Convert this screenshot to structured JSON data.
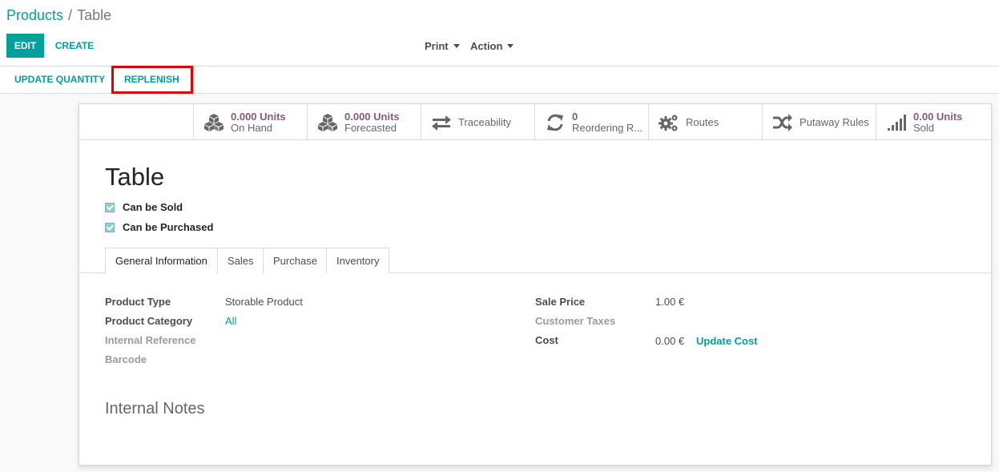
{
  "breadcrumb": {
    "parent": "Products",
    "separator": "/",
    "current": "Table"
  },
  "toolbar": {
    "edit_label": "EDIT",
    "create_label": "CREATE",
    "print_label": "Print",
    "action_label": "Action"
  },
  "statusbar": {
    "update_quantity_label": "UPDATE QUANTITY",
    "replenish_label": "REPLENISH"
  },
  "smart_buttons": [
    {
      "value": "0.000 Units",
      "label": "On Hand",
      "icon": "cubes-icon"
    },
    {
      "value": "0.000 Units",
      "label": "Forecasted",
      "icon": "cubes-icon"
    },
    {
      "label": "Traceability",
      "icon": "exchange-arrows-icon"
    },
    {
      "value": "0",
      "label": "Reordering R...",
      "icon": "refresh-icon"
    },
    {
      "label": "Routes",
      "icon": "gears-icon"
    },
    {
      "label": "Putaway Rules",
      "icon": "random-icon"
    },
    {
      "value": "0.00 Units",
      "label": "Sold",
      "icon": "signal-bars-icon"
    }
  ],
  "product": {
    "name": "Table",
    "can_be_sold_label": "Can be Sold",
    "can_be_purchased_label": "Can be Purchased"
  },
  "tabs": [
    "General Information",
    "Sales",
    "Purchase",
    "Inventory"
  ],
  "general_info": {
    "product_type_label": "Product Type",
    "product_type_value": "Storable Product",
    "product_category_label": "Product Category",
    "product_category_value": "All",
    "internal_reference_label": "Internal Reference",
    "barcode_label": "Barcode",
    "sale_price_label": "Sale Price",
    "sale_price_value": "1.00 €",
    "customer_taxes_label": "Customer Taxes",
    "cost_label": "Cost",
    "cost_value": "0.00 €",
    "update_cost_label": "Update Cost"
  },
  "notes": {
    "title": "Internal Notes"
  },
  "colors": {
    "accent": "#00a09d",
    "stat_value": "#875a7b",
    "highlight": "#e00000"
  }
}
